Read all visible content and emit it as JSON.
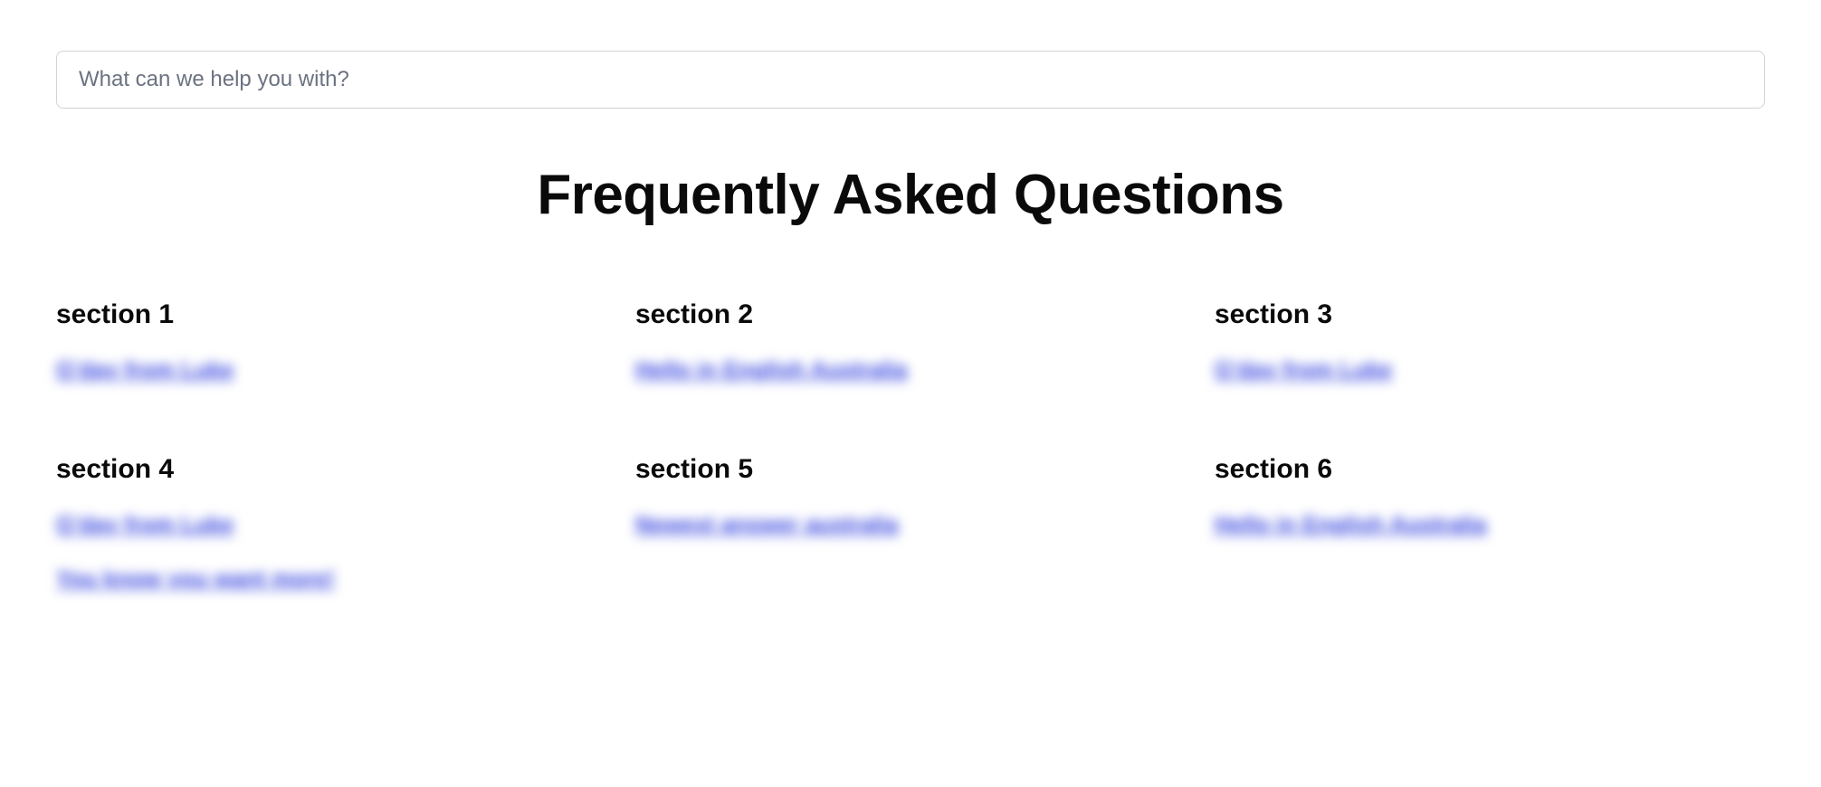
{
  "search": {
    "placeholder": "What can we help you with?",
    "value": ""
  },
  "page_title": "Frequently Asked Questions",
  "sections": [
    {
      "title": "section 1",
      "links": [
        "G'day from Luke"
      ]
    },
    {
      "title": "section 2",
      "links": [
        "Hello in English Australia"
      ]
    },
    {
      "title": "section 3",
      "links": [
        "G'day from Luke"
      ]
    },
    {
      "title": "section 4",
      "links": [
        "G'day from Luke",
        "You know you want more!"
      ]
    },
    {
      "title": "section 5",
      "links": [
        "Newest answer australia"
      ]
    },
    {
      "title": "section 6",
      "links": [
        "Hello in English Australia"
      ]
    }
  ]
}
